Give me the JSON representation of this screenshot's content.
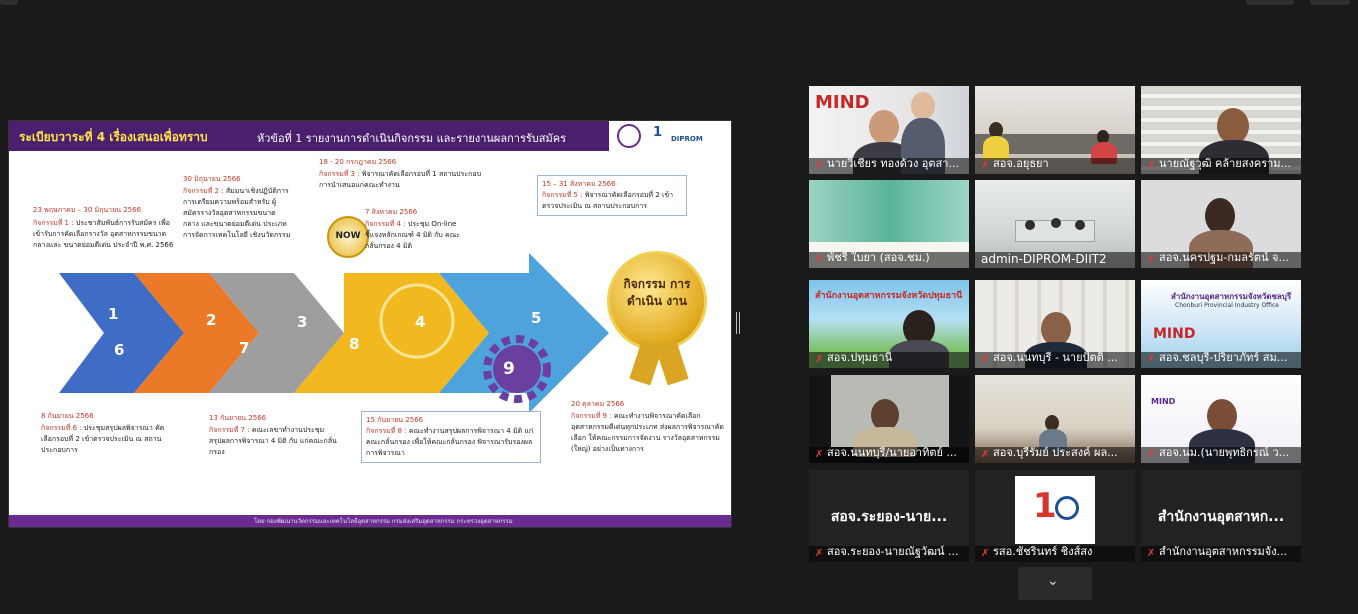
{
  "slide": {
    "title_highlight": "ระเบียบวาระที่ 4 เรื่องเสนอเพื่อทราบ",
    "title_rest": "หัวข้อที่ 1 รายงานการดำเนินกิจกรรม และรายงานผลการรับสมัคร",
    "logo_text": "DIPROM",
    "footer": "โดย กองพัฒนานวัตกรรมและเทคโนโลยีอุตสาหกรรม กรมส่งเสริมอุตสาหกรรม กระทรวงอุตสาหกรรม",
    "now_label": "NOW",
    "badge_label": "กิจกรรม การดำเนิน งาน",
    "steps": {
      "s1": {
        "num": "1",
        "date": "23 พฤษภาคม – 30 มิถุนายน 2566",
        "label": "กิจกรรมที่ 1 :",
        "text": "ประชาสัมพันธ์การรับสมัคร เพื่อเข้ารับการคัดเลือกรางวัล อุตสาหกรรมขนาดกลางและ ขนาดย่อมดีเด่น ประจำปี พ.ศ. 2566"
      },
      "s2": {
        "num": "2",
        "date": "30 มิถุนายน 2566",
        "label": "กิจกรรมที่ 2 :",
        "text": "สัมมนาเชิงปฏิบัติการ การเตรียมความพร้อมสำหรับ ผู้สมัครรางวัลอุตสาหกรรมขนาดกลาง และขนาดย่อมดีเด่น ประเภทการจัดการเทคโนโลยี เชิงนวัตกรรม"
      },
      "s3": {
        "num": "3",
        "date": "18 - 20 กรกฎาคม 2566",
        "label": "กิจกรรมที่ 3 :",
        "text": "พิจารณาคัดเลือกรอบที่ 1 สถานประกอบการนำเสนอแก่คณะทำงาน"
      },
      "s4": {
        "num": "4",
        "date": "7 สิงหาคม 2566",
        "label": "กิจกรรมที่ 4 :",
        "text": "ประชุม On-line ชี้แจงหลักเกณฑ์ 4 มิติ กับ คณะกลั่นกรอง 4 มิติ"
      },
      "s5": {
        "num": "5",
        "date": "15 – 31 สิงหาคม 2566",
        "label": "กิจกรรมที่ 5 :",
        "text": "พิจารณาคัดเลือกรอบที่ 2 เข้าตรวจประเมิน ณ สถานประกอบการ"
      },
      "s6": {
        "num": "6",
        "date": "8 กันยายน 2566",
        "label": "กิจกรรมที่ 6 :",
        "text": "ประชุมสรุปผลพิจารณา คัดเลือกรอบที่ 2 เข้าตรวจประเมิน ณ สถานประกอบการ"
      },
      "s7": {
        "num": "7",
        "date": "13 กันยายน 2566",
        "label": "กิจกรรมที่ 7 :",
        "text": "คณะเลขาทำงานประชุม สรุปผลการพิจารณา 4 มิติ กับ แก่คณะกลั่นกรอง"
      },
      "s8": {
        "num": "8",
        "date": "15 กันยายน 2566",
        "label": "กิจกรรมที่ 8 :",
        "text": "คณะทำงานสรุปผลการพิจารณา 4 มิติ แก่คณะกลั่นกรอง เพื่อให้คณะกลั่นกรอง พิจารณารับรองผลการพิจารณา"
      },
      "s9": {
        "num": "9",
        "date": "20 ตุลาคม 2566",
        "label": "กิจกรรมที่ 9 :",
        "text": "คณะทำงานพิจารณาคัดเลือก อุตสาหกรรมดีเด่นทุกประเภท ส่งผลการพิจารณาคัดเลือก ให้คณะกรรมการจัดงาน รางวัลอุตสาหกรรม (ใหญ่) อย่างเป็นทางการ"
      }
    }
  },
  "gallery": {
    "tiles": [
      {
        "name": "นายวิเชียร ทองด้วง อุตสา..."
      },
      {
        "name": "สอจ.อยุธยา"
      },
      {
        "name": "นายณัฐวุฒิ คล้ายสงคราม..."
      },
      {
        "name": "พัชรี ใบยา (สอจ.ชม.)"
      },
      {
        "name": "admin-DIPROM-DIIT2"
      },
      {
        "name": "สอจ.นครปฐม-กมลรัตน์ จ..."
      },
      {
        "name": "สอจ.ปทุมธานี"
      },
      {
        "name": "สอจ.นนทบุรี - นายปัตติ ..."
      },
      {
        "name": "สอจ.ชลบุรี-ปริยาภัทร์ สม..."
      },
      {
        "name": "สอจ.นนทบุรี/นายอาทิตย์ ..."
      },
      {
        "name": "สอจ.บุรีรัมย์ ประสงค์ ผล..."
      },
      {
        "name": "สอจ.นม.(นายพุทธิกรณ์ ว..."
      },
      {
        "name": "สอจ.ระยอง-นายณัฐวัฒน์ ...",
        "big": "สอจ.ระยอง-นาย..."
      },
      {
        "name": "รสอ.ชัชรินทร์ ชิงส์สง"
      },
      {
        "name": "สำนักงานอุตสาหกรรมจัง...",
        "big": "สำนักงานอุตสาหก..."
      }
    ],
    "banner_texts": {
      "mind": "MIND",
      "pathum": "สำนักงานอุตสาหกรรมจังหวัดปทุมธานี",
      "chonburi_th": "สำนักงานอุตสาหกรรมจังหวัดชลบุรี",
      "chonburi_en": "Chonburi Provincial Industry Office"
    }
  },
  "colors": {
    "accent_active": "#c8d63a",
    "slide_purple": "#4a1f6e",
    "muted_mic": "#e53935"
  },
  "icons": {
    "mic": "mic-muted-icon",
    "more": "chevron-down-icon"
  }
}
